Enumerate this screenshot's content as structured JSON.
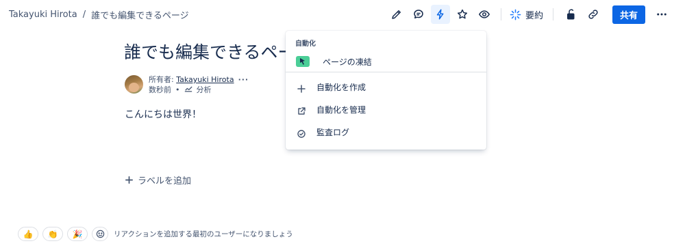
{
  "breadcrumb": {
    "space": "Takayuki Hirota",
    "separator": "/",
    "page": "誰でも編集できるページ"
  },
  "toolbar": {
    "icons": [
      "edit-icon",
      "comment-icon",
      "automation-icon",
      "star-icon",
      "watch-icon",
      "restrictions-icon",
      "link-icon",
      "more-icon"
    ],
    "summary_label": "要約",
    "share_label": "共有",
    "accent": "#0c66e4"
  },
  "page": {
    "title": "誰でも編集できるペー",
    "owner_prefix": "所有者: ",
    "owner_name": "Takayuki Hirota",
    "owner_more": "···",
    "updated": "数秒前",
    "dot": "•",
    "analytics_label": "分析",
    "body": "こんにちは世界！"
  },
  "labels": {
    "add_label": "ラベルを追加"
  },
  "reactions": {
    "items": [
      "👍",
      "👏",
      "🎉"
    ],
    "hint": "リアクションを追加する最初のユーザーになりましょう"
  },
  "automation_menu": {
    "heading": "自動化",
    "featured_rule": "ページの凍結",
    "items": [
      {
        "label": "自動化を作成",
        "icon": "plus-icon"
      },
      {
        "label": "自動化を管理",
        "icon": "external-link-icon"
      },
      {
        "label": "監査ログ",
        "icon": "check-circle-icon"
      }
    ],
    "rule_icon_color": "#4bce97"
  }
}
